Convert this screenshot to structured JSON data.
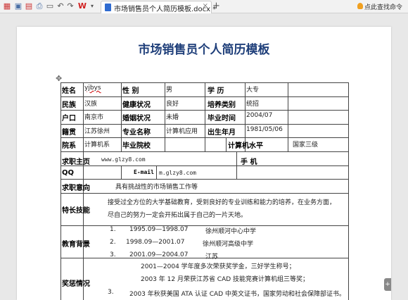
{
  "toolbar": {
    "icons": [
      "app-menu-icon",
      "save-icon",
      "export-pdf-icon",
      "print-icon",
      "undo-icon",
      "redo-icon",
      "wps-logo-icon",
      "dropdown-icon"
    ],
    "tab_title": "市场销售员个人简历模板.docx *",
    "tab_close": "×",
    "tab_add": "+",
    "assistant": "点此查找命令"
  },
  "document": {
    "title": "市场销售员个人简历模板",
    "move_handle": "✥",
    "side_grip": "+",
    "labels": {
      "name": "姓名",
      "gender": "性    别",
      "education": "学    历",
      "ethnicity": "民族",
      "health": "健康状况",
      "training_type": "培养类别",
      "hukou": "户口",
      "marital": "婚姻状况",
      "grad_date": "毕业时间",
      "origin": "籍贯",
      "major": "专业名称",
      "birth_date": "出生年月",
      "department": "院系",
      "grad_school": "毕业院校",
      "computer_level": "计算机水平",
      "homepage": "求职主页",
      "mobile": "手    机",
      "qq": "QQ",
      "email": "E-mail",
      "job_intent": "求职意向",
      "skills": "特长技能",
      "edu_background": "教育背景",
      "awards": "奖惩情况"
    },
    "values": {
      "name": "yjbys",
      "gender": "男",
      "education": "大专",
      "ethnicity": "汉族",
      "health": "良好",
      "training_type": "统招",
      "hukou": "南京市",
      "marital": "未婚",
      "grad_date": "2004/07",
      "origin": "江苏徐州",
      "major": "计算机应用",
      "birth_date": "1981/05/06",
      "department": "计算机系",
      "computer_level": "国家三级",
      "homepage": "www.glzy8.com",
      "email": "m.glzy8.com",
      "job_intent": "具有挑战性的市场销售工作等",
      "skills_line1": "接受过全方位的大学基础教育，受到良好的专业训练和能力的培养，在业务方面，",
      "skills_line2": "尽自己的努力一定会开拓出属于自己的一片天地。"
    },
    "education": [
      {
        "num": "1.",
        "period": "1995.09—1998.07",
        "school": "徐州顺河中心中学"
      },
      {
        "num": "2.",
        "period": "1998.09—2001.07",
        "school": "徐州顺河高级中学"
      },
      {
        "num": "3.",
        "period": "2001.09—2004.07",
        "school": "江苏"
      }
    ],
    "awards": [
      {
        "num": "",
        "text": "2001—2004 学年度多次荣获奖学金，三好学生称号；"
      },
      {
        "num": "",
        "text": "2003 年 12 月荣获江苏省 CAD 技能竞赛计算机组三等奖；"
      },
      {
        "num": "3.",
        "text": "2003 年秋获美国 ATA 认证 CAD 中英文证书，国家劳动和社会保障部证书。"
      }
    ]
  }
}
